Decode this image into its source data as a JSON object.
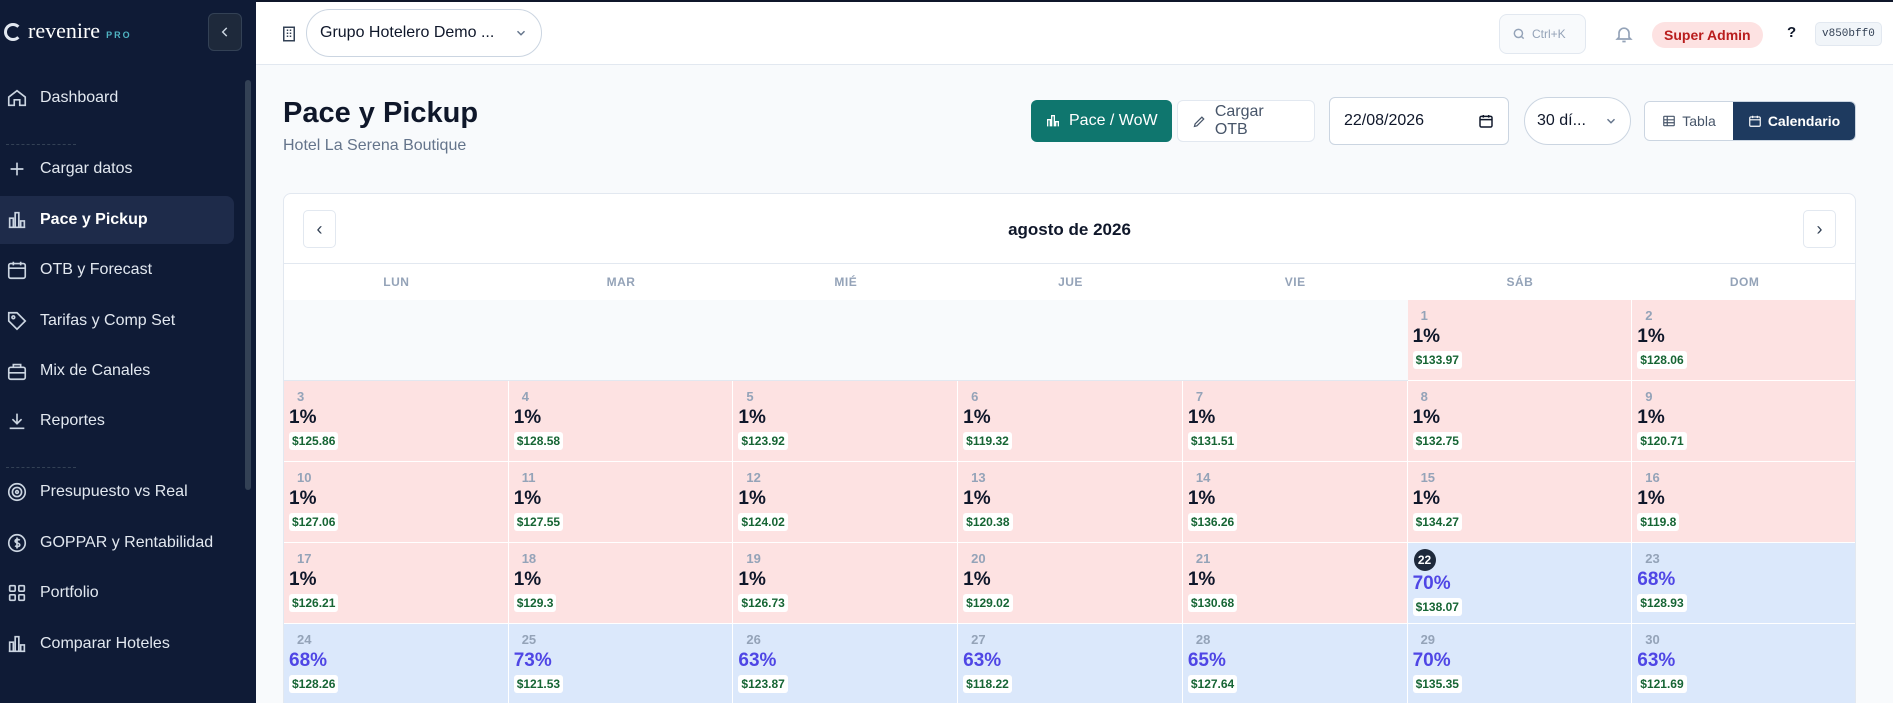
{
  "brand": {
    "name": "revenire",
    "badge": "PRO"
  },
  "sidebar": {
    "items": [
      {
        "label": "Dashboard",
        "icon": "home-icon"
      },
      {
        "label": "Cargar datos",
        "icon": "plus-icon"
      },
      {
        "label": "Pace y Pickup",
        "icon": "bar-chart-icon",
        "active": true
      },
      {
        "label": "OTB y Forecast",
        "icon": "calendar-icon"
      },
      {
        "label": "Tarifas y Comp Set",
        "icon": "tag-icon"
      },
      {
        "label": "Mix de Canales",
        "icon": "briefcase-icon"
      },
      {
        "label": "Reportes",
        "icon": "download-icon"
      },
      {
        "label": "Presupuesto vs Real",
        "icon": "target-icon"
      },
      {
        "label": "GOPPAR y Rentabilidad",
        "icon": "dollar-icon"
      },
      {
        "label": "Portfolio",
        "icon": "grid-icon"
      },
      {
        "label": "Comparar Hoteles",
        "icon": "bar-chart-icon"
      }
    ]
  },
  "topbar": {
    "hotel_group": "Grupo Hotelero Demo ...",
    "search_hint": "Ctrl+K",
    "role": "Super Admin",
    "help": "?",
    "version": "v850bff0"
  },
  "page": {
    "title": "Pace y Pickup",
    "subtitle": "Hotel La Serena Boutique"
  },
  "toolbar": {
    "pace_label": "Pace / WoW",
    "otb_label": "Cargar OTB",
    "date": "22/08/2026",
    "range": "30 dí...",
    "view_table": "Tabla",
    "view_calendar": "Calendario"
  },
  "calendar": {
    "month": "agosto de 2026",
    "weekdays": [
      "LUN",
      "MAR",
      "MIÉ",
      "JUE",
      "VIE",
      "SÁB",
      "DOM"
    ],
    "leading_empty": 5,
    "today": 22,
    "days": [
      {
        "d": "1",
        "occ": "1%",
        "adr": "$133.97"
      },
      {
        "d": "2",
        "occ": "1%",
        "adr": "$128.06"
      },
      {
        "d": "3",
        "occ": "1%",
        "adr": "$125.86"
      },
      {
        "d": "4",
        "occ": "1%",
        "adr": "$128.58"
      },
      {
        "d": "5",
        "occ": "1%",
        "adr": "$123.92"
      },
      {
        "d": "6",
        "occ": "1%",
        "adr": "$119.32"
      },
      {
        "d": "7",
        "occ": "1%",
        "adr": "$131.51"
      },
      {
        "d": "8",
        "occ": "1%",
        "adr": "$132.75"
      },
      {
        "d": "9",
        "occ": "1%",
        "adr": "$120.71"
      },
      {
        "d": "10",
        "occ": "1%",
        "adr": "$127.06"
      },
      {
        "d": "11",
        "occ": "1%",
        "adr": "$127.55"
      },
      {
        "d": "12",
        "occ": "1%",
        "adr": "$124.02"
      },
      {
        "d": "13",
        "occ": "1%",
        "adr": "$120.38"
      },
      {
        "d": "14",
        "occ": "1%",
        "adr": "$136.26"
      },
      {
        "d": "15",
        "occ": "1%",
        "adr": "$134.27"
      },
      {
        "d": "16",
        "occ": "1%",
        "adr": "$119.8"
      },
      {
        "d": "17",
        "occ": "1%",
        "adr": "$126.21"
      },
      {
        "d": "18",
        "occ": "1%",
        "adr": "$129.3"
      },
      {
        "d": "19",
        "occ": "1%",
        "adr": "$126.73"
      },
      {
        "d": "20",
        "occ": "1%",
        "adr": "$129.02"
      },
      {
        "d": "21",
        "occ": "1%",
        "adr": "$130.68"
      },
      {
        "d": "22",
        "occ": "70%",
        "adr": "$138.07"
      },
      {
        "d": "23",
        "occ": "68%",
        "adr": "$128.93"
      },
      {
        "d": "24",
        "occ": "68%",
        "adr": "$128.26"
      },
      {
        "d": "25",
        "occ": "73%",
        "adr": "$121.53"
      },
      {
        "d": "26",
        "occ": "63%",
        "adr": "$123.87"
      },
      {
        "d": "27",
        "occ": "63%",
        "adr": "$118.22"
      },
      {
        "d": "28",
        "occ": "65%",
        "adr": "$127.64"
      },
      {
        "d": "29",
        "occ": "70%",
        "adr": "$135.35"
      },
      {
        "d": "30",
        "occ": "63%",
        "adr": "$121.69"
      }
    ]
  }
}
